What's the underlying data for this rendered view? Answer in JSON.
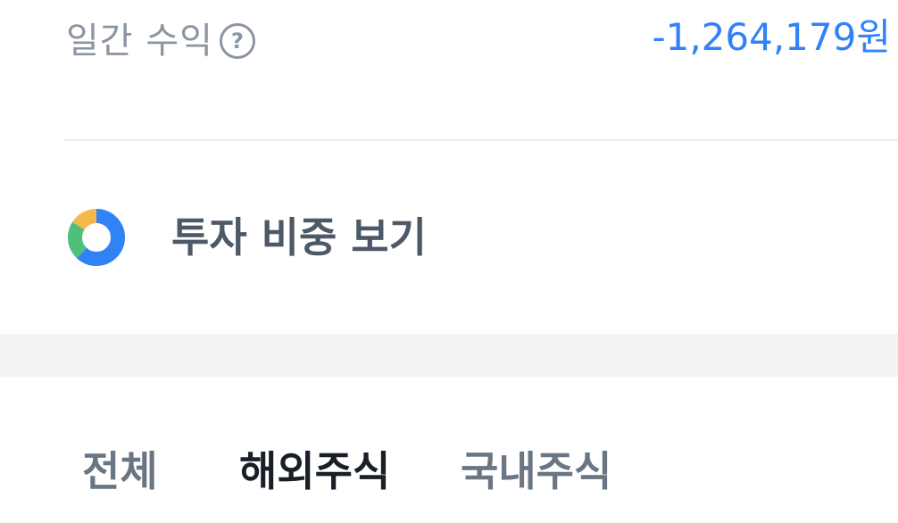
{
  "daily_profit": {
    "label": "일간 수익",
    "help_icon": "question-circle",
    "value": "-1,264,179원",
    "value_color": "#3182f6"
  },
  "investment_ratio": {
    "icon": "donut-chart",
    "label": "투자 비중 보기",
    "segments": [
      {
        "color": "#3182f6",
        "fraction": 0.62
      },
      {
        "color": "#4fc07a",
        "fraction": 0.22
      },
      {
        "color": "#f5b94a",
        "fraction": 0.16
      }
    ]
  },
  "tabs": [
    {
      "label": "전체",
      "active": false
    },
    {
      "label": "해외주식",
      "active": true
    },
    {
      "label": "국내주식",
      "active": false
    }
  ]
}
